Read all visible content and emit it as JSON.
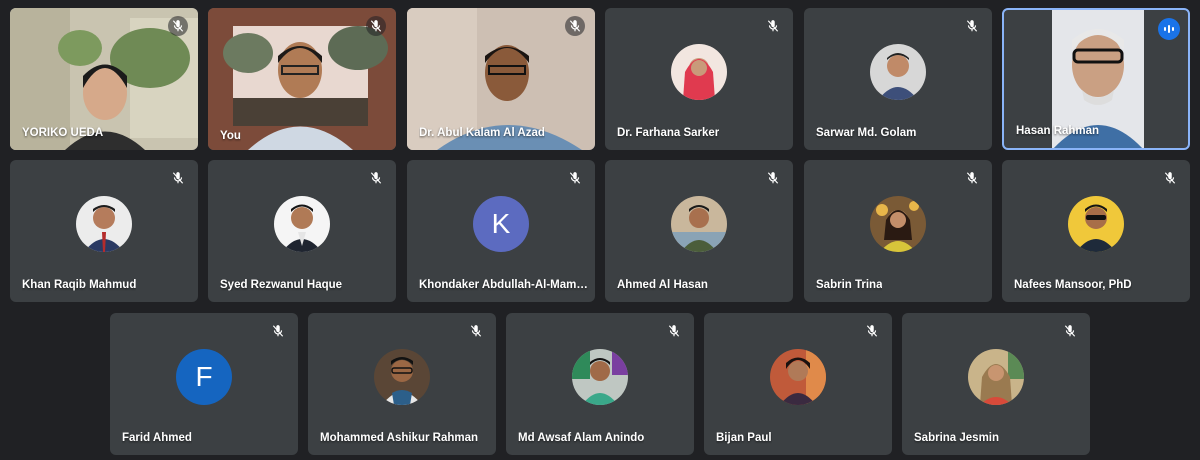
{
  "participants": [
    {
      "name": "YORIKO UEDA"
    },
    {
      "name": "You"
    },
    {
      "name": "Dr. Abul Kalam Al Azad"
    },
    {
      "name": "Dr. Farhana Sarker"
    },
    {
      "name": "Sarwar Md. Golam"
    },
    {
      "name": "Hasan Rahman"
    },
    {
      "name": "Khan Raqib Mahmud"
    },
    {
      "name": "Syed Rezwanul Haque"
    },
    {
      "name": "Khondaker Abdullah-Al-Mamun",
      "initial": "K"
    },
    {
      "name": "Ahmed Al Hasan"
    },
    {
      "name": "Sabrin Trina"
    },
    {
      "name": "Nafees Mansoor, PhD"
    },
    {
      "name": "Farid Ahmed",
      "initial": "F"
    },
    {
      "name": "Mohammed Ashikur Rahman"
    },
    {
      "name": "Md Awsaf Alam Anindo"
    },
    {
      "name": "Bijan Paul"
    },
    {
      "name": "Sabrina Jesmin"
    }
  ],
  "colors": {
    "background": "#202124",
    "tile": "#3c4043",
    "speaking_border": "#8ab4f8",
    "speaking_badge": "#1a73e8",
    "avatar_k": "#5c6bc0",
    "avatar_f": "#1565c0"
  },
  "icons": {
    "muted": "mic-off-icon",
    "speaking": "audio-level-icon"
  }
}
